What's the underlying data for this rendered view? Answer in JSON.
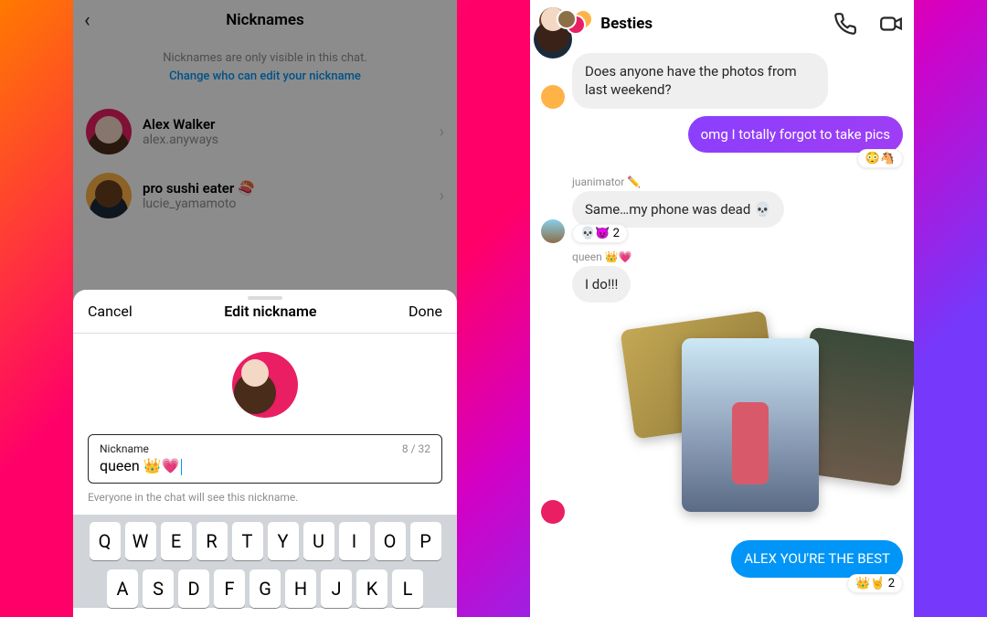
{
  "left": {
    "title": "Nicknames",
    "hint1": "Nicknames are only visible in this chat.",
    "hint2": "Change who can edit your nickname",
    "users": [
      {
        "name": "Alex Walker",
        "username": "alex.anyways"
      },
      {
        "name": "pro sushi eater 🍣",
        "username": "lucie_yamamoto"
      }
    ],
    "sheet": {
      "cancel": "Cancel",
      "title": "Edit nickname",
      "done": "Done",
      "fieldLabel": "Nickname",
      "counter": "8 / 32",
      "value": "queen 👑💗",
      "hint": "Everyone in the chat will see this nickname."
    },
    "keyboard": {
      "row1": [
        "Q",
        "W",
        "E",
        "R",
        "T",
        "Y",
        "U",
        "I",
        "O",
        "P"
      ],
      "row2": [
        "A",
        "S",
        "D",
        "F",
        "G",
        "H",
        "J",
        "K",
        "L"
      ]
    }
  },
  "right": {
    "title": "Besties",
    "messages": {
      "m1": "Does anyone have the photos from last weekend?",
      "m2": "omg I totally forgot to take pics",
      "m2_react": "😳🐴",
      "m3_sender": "juanimator ✏️",
      "m3": "Same…my phone was dead 💀",
      "m3_react": "💀😈 2",
      "m4_sender": "queen 👑💗",
      "m4": "I do!!!",
      "m5": "ALEX YOU'RE THE BEST",
      "m5_react": "👑🤘 2"
    }
  }
}
